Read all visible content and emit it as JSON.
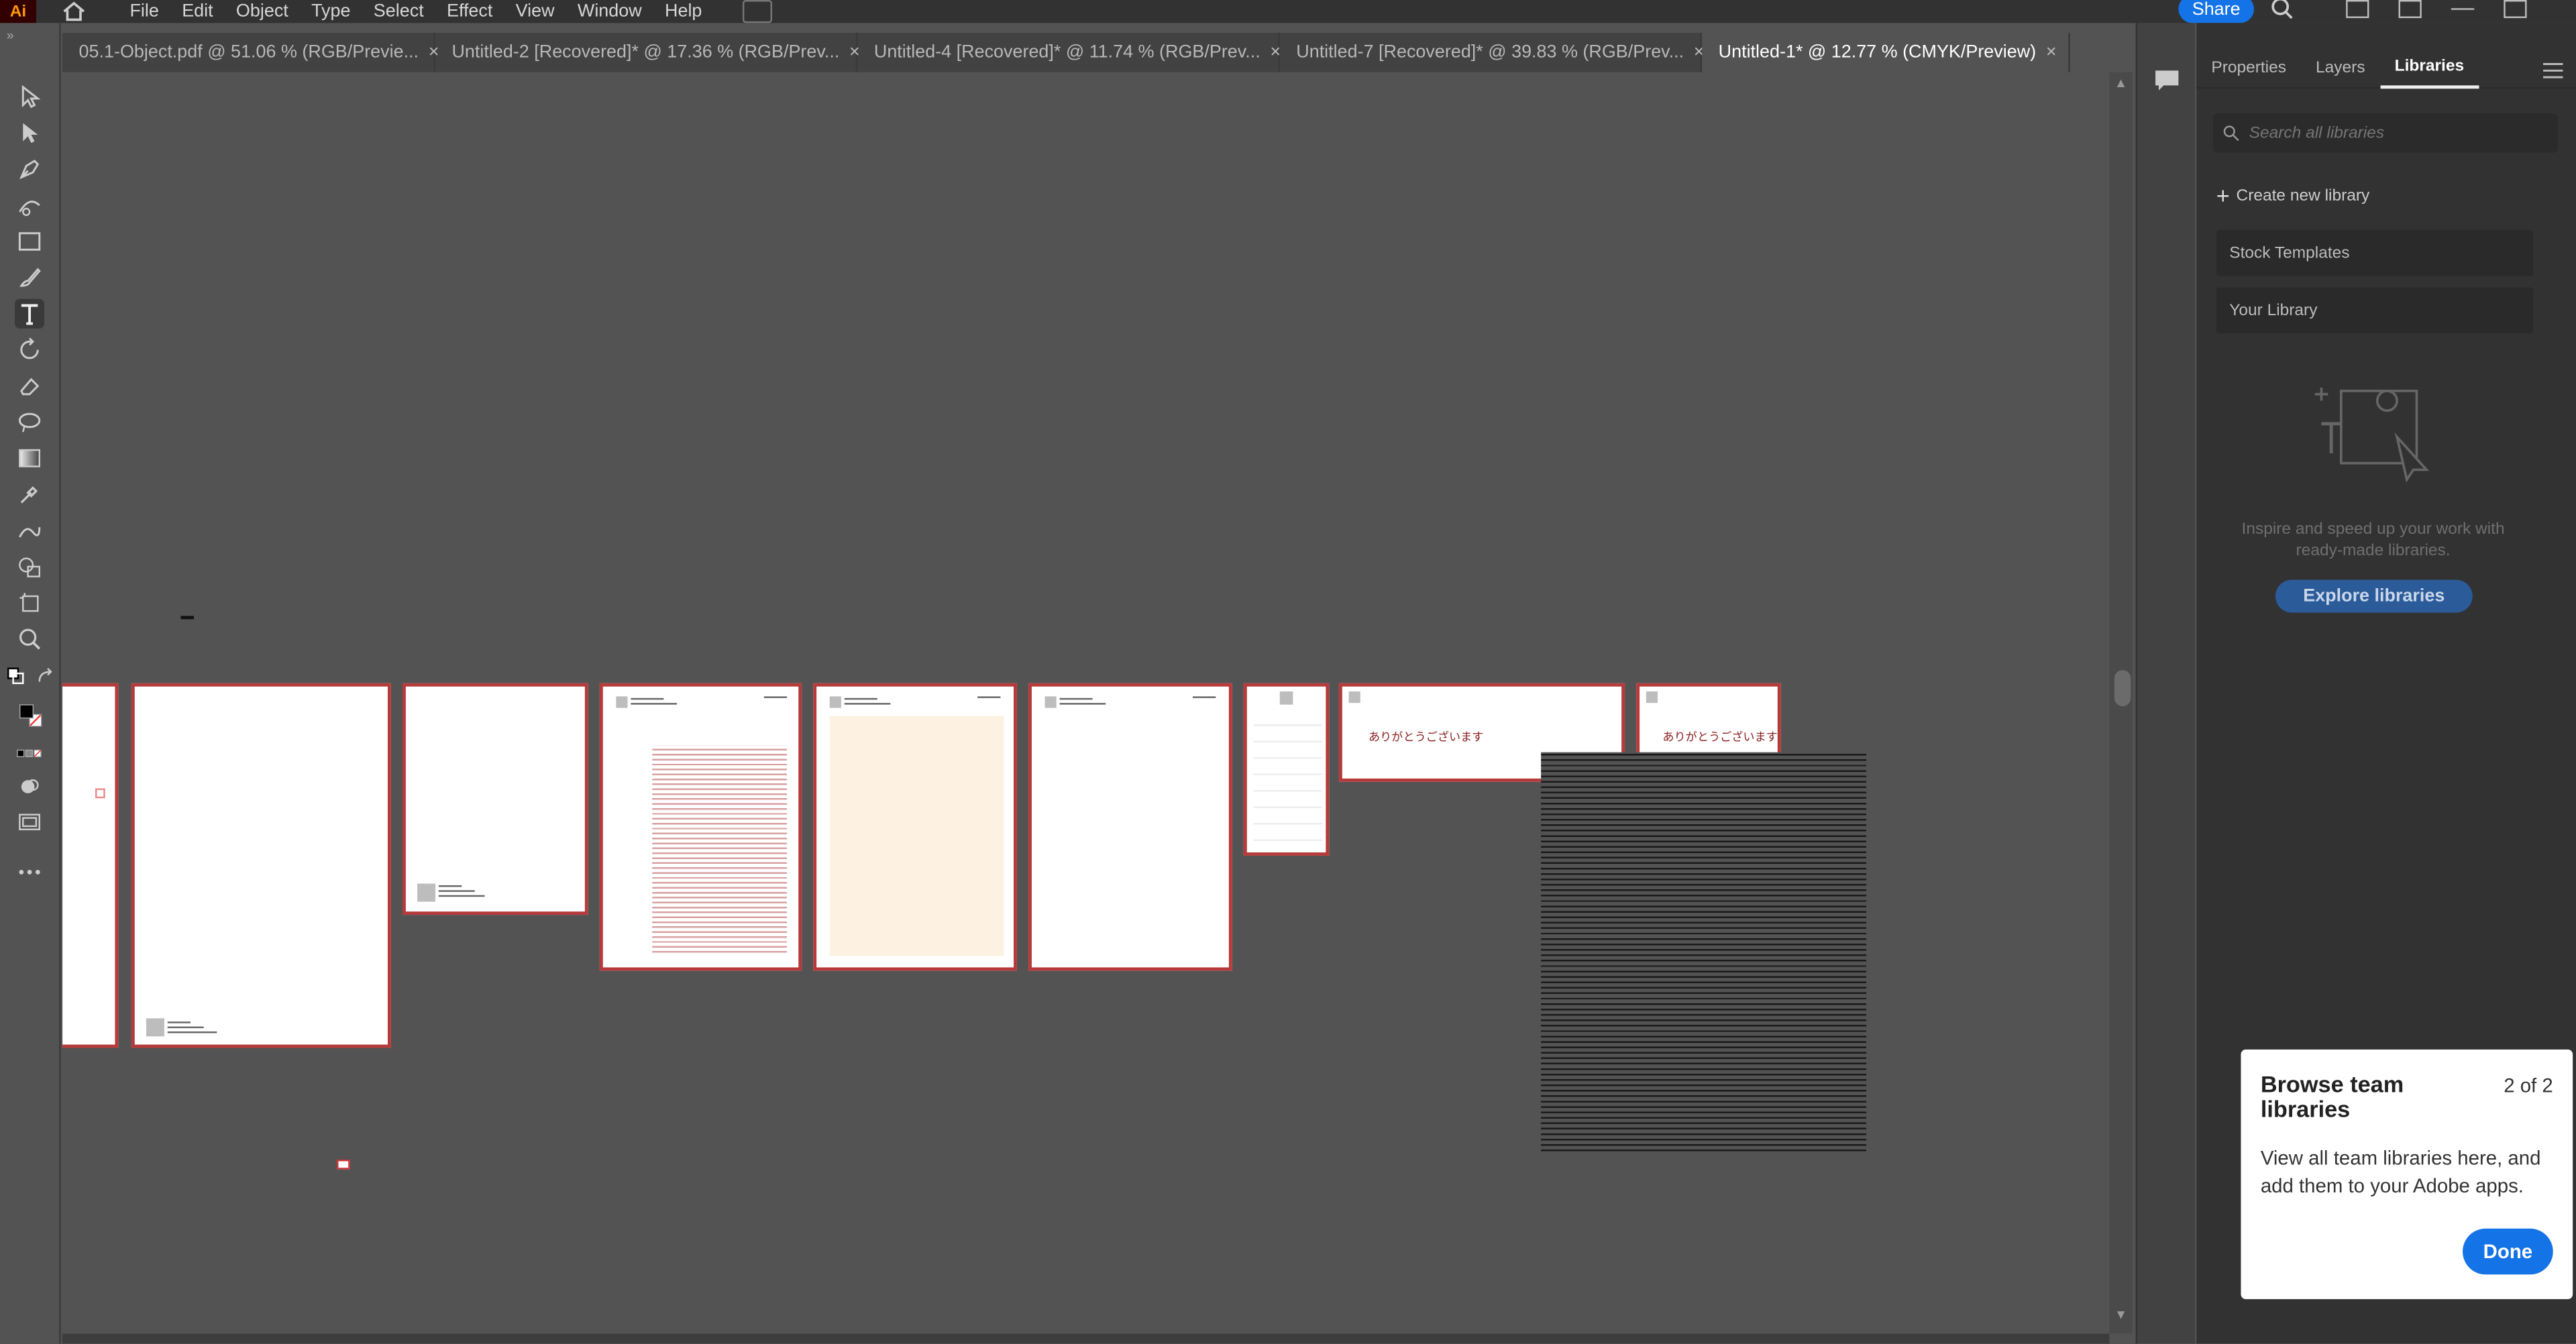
{
  "app": {
    "logo": "Ai"
  },
  "menu": [
    "File",
    "Edit",
    "Object",
    "Type",
    "Select",
    "Effect",
    "View",
    "Window",
    "Help"
  ],
  "topbar": {
    "share_label": "Share"
  },
  "tabs": [
    {
      "label": "05.1-Object.pdf @ 51.06 % (RGB/Previe...",
      "active": false
    },
    {
      "label": "Untitled-2 [Recovered]* @ 17.36 % (RGB/Prev...",
      "active": false
    },
    {
      "label": "Untitled-4 [Recovered]* @ 11.74 % (RGB/Prev...",
      "active": false
    },
    {
      "label": "Untitled-7 [Recovered]* @ 39.83 % (RGB/Prev...",
      "active": false
    },
    {
      "label": "Untitled-1* @ 12.77 % (CMYK/Preview)",
      "active": true
    }
  ],
  "tab_close_glyph": "×",
  "artboard_text": {
    "thanks_jp": "ありがとうございます"
  },
  "panel": {
    "tabs": [
      "Properties",
      "Layers",
      "Libraries"
    ],
    "active_tab": "Libraries",
    "search_placeholder": "Search all libraries",
    "create_label": "Create new library",
    "items": [
      "Stock Templates",
      "Your Library"
    ],
    "description": "Inspire and speed up your work with ready-made libraries.",
    "explore_label": "Explore libraries"
  },
  "popover": {
    "title": "Browse team libraries",
    "count": "2 of 2",
    "body": "View all team libraries here, and add them to your Adobe apps.",
    "done_label": "Done"
  },
  "colors": {
    "accent": "#1473e6",
    "artboard_border": "#b73a3a",
    "canvas": "#535353",
    "panel": "#323232"
  }
}
